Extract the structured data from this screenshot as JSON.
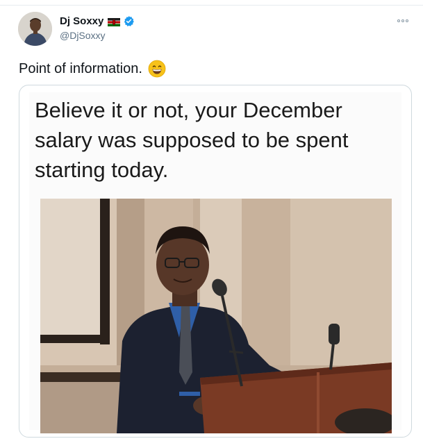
{
  "author": {
    "name": "Dj Soxxy",
    "handle": "@DjSoxxy",
    "flag_icon": "kenya-flag-emoji",
    "verified_icon": "verified-badge-icon"
  },
  "tweet": {
    "text": "Point of information.",
    "emoji": "grinning-face-emoji"
  },
  "media": {
    "caption": "Believe it or not, your December salary was supposed to be spent starting today.",
    "photo_subject": "man-at-podium-photo"
  },
  "colors": {
    "text_primary": "#0f1419",
    "text_secondary": "#5b7083",
    "verified_blue": "#1d9bf0",
    "border": "#cfd9de"
  }
}
